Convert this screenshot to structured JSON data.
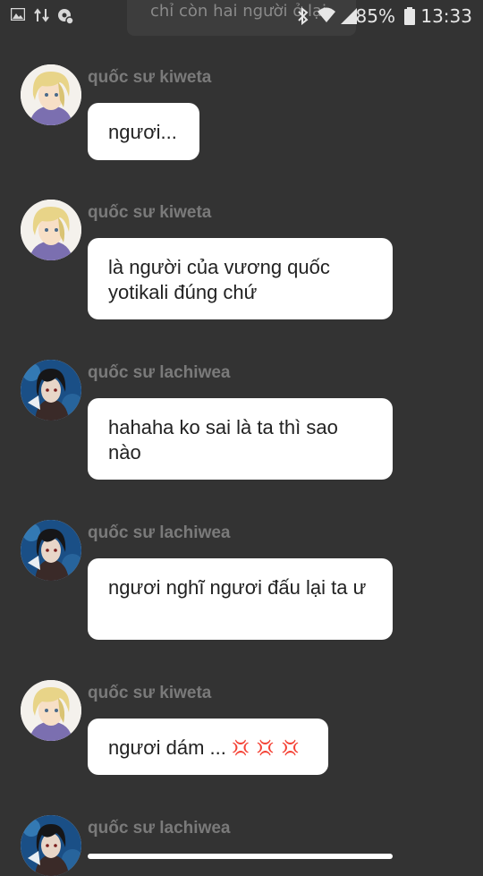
{
  "status_bar": {
    "title_overlay": "chỉ còn hai người ở lại",
    "battery": "85%",
    "time": "13:33",
    "icons": [
      "image-icon",
      "data-transfer-icon",
      "settings-notification-icon",
      "bluetooth-icon",
      "wifi-icon",
      "signal-icon",
      "battery-icon"
    ]
  },
  "users": {
    "kiweta": {
      "name": "quốc sư kiweta",
      "avatar": "blonde-character-avatar"
    },
    "lachiwea": {
      "name": "quốc sư lachiwea",
      "avatar": "dark-hair-character-avatar"
    }
  },
  "messages": [
    {
      "sender": "quốc sư kiweta",
      "text": "ngươi..."
    },
    {
      "sender": "quốc sư kiweta",
      "text": "là người của vương quốc yotikali đúng chứ"
    },
    {
      "sender": "quốc sư lachiwea",
      "text": "hahaha ko sai là ta thì sao nào"
    },
    {
      "sender": "quốc sư lachiwea",
      "text": "ngươi nghĩ ngươi đấu lại ta ư"
    },
    {
      "sender": "quốc sư kiweta",
      "text": "ngươi dám ...",
      "emoji": "💢💢💢"
    },
    {
      "sender": "quốc sư lachiwea",
      "text": ""
    }
  ],
  "colors": {
    "background": "#333333",
    "bubble": "#ffffff",
    "sender_name": "#7a7a7a",
    "text": "#222222"
  }
}
